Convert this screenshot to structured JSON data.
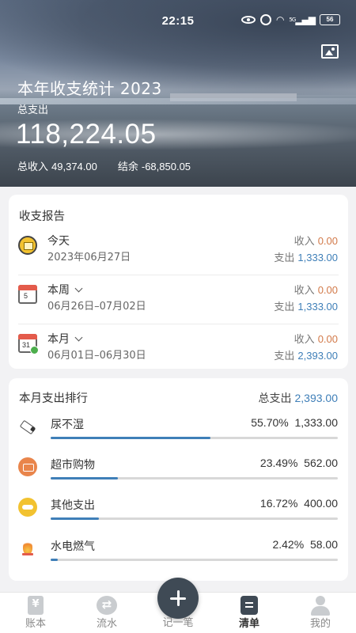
{
  "status_bar": {
    "time": "22:15",
    "battery": "56",
    "signal": "5G",
    "icons": [
      "eye-icon",
      "alarm-icon",
      "wifi-icon",
      "signal-icon",
      "battery-icon"
    ]
  },
  "hero": {
    "title": "本年收支统计 2023",
    "total_expense_label": "总支出",
    "total_expense": "118,224.05",
    "total_income_label": "总收入",
    "total_income": "49,374.00",
    "balance_label": "结余",
    "balance": "-68,850.05",
    "image_button_icon": "image-icon"
  },
  "report": {
    "title": "收支报告",
    "income_label": "收入",
    "expense_label": "支出",
    "rows": [
      {
        "name": "今天",
        "date": "2023年06月27日",
        "income": "0.00",
        "expense": "1,333.00",
        "icon": "wallet-icon",
        "has_dropdown": false
      },
      {
        "name": "本周",
        "date": "06月26日–07月02日",
        "income": "0.00",
        "expense": "1,333.00",
        "icon": "calendar-week-icon",
        "cal_num": "5",
        "has_dropdown": true
      },
      {
        "name": "本月",
        "date": "06月01日–06月30日",
        "income": "0.00",
        "expense": "2,393.00",
        "icon": "calendar-month-icon",
        "cal_num": "31",
        "has_dropdown": true
      }
    ]
  },
  "ranking": {
    "title": "本月支出排行",
    "total_label": "总支出",
    "total": "2,393.00",
    "items": [
      {
        "name": "尿不湿",
        "percent": "55.70%",
        "amount": "1,333.00",
        "ratio": 0.557,
        "icon": "diaper-icon"
      },
      {
        "name": "超市购物",
        "percent": "23.49%",
        "amount": "562.00",
        "ratio": 0.2349,
        "icon": "shopping-cart-icon"
      },
      {
        "name": "其他支出",
        "percent": "16.72%",
        "amount": "400.00",
        "ratio": 0.1672,
        "icon": "other-expense-icon"
      },
      {
        "name": "水电燃气",
        "percent": "2.42%",
        "amount": "58.00",
        "ratio": 0.0242,
        "icon": "utility-fire-icon"
      }
    ]
  },
  "tabbar": {
    "tabs": [
      {
        "label": "账本",
        "icon": "ledger-icon",
        "active": false
      },
      {
        "label": "流水",
        "icon": "transfer-icon",
        "active": false
      },
      {
        "label": "记一笔",
        "icon": "add-icon",
        "active": false
      },
      {
        "label": "清单",
        "icon": "list-icon",
        "active": true
      },
      {
        "label": "我的",
        "icon": "profile-icon",
        "active": false
      }
    ]
  },
  "colors": {
    "income": "#d27a4a",
    "expense": "#3f7fb8",
    "bar_track": "#d8d8d8",
    "fab": "#3f4a55"
  }
}
